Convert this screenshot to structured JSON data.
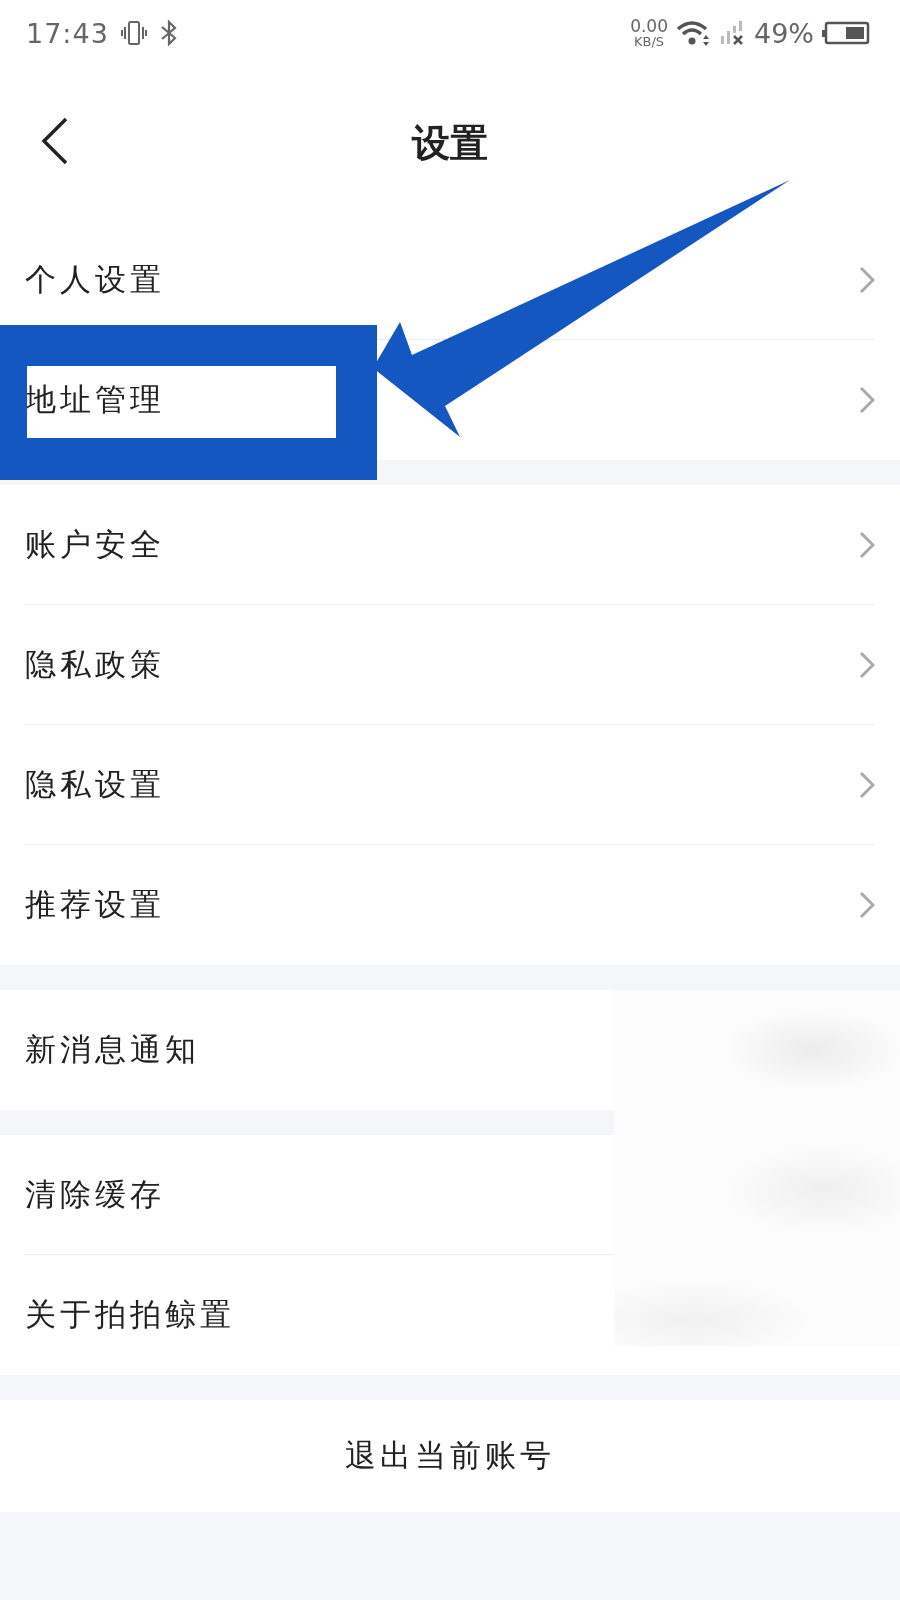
{
  "status_bar": {
    "time": "17:43",
    "speed_value": "0.00",
    "speed_unit": "KB/S",
    "battery": "49%"
  },
  "header": {
    "title": "设置"
  },
  "groups": [
    {
      "rows": [
        {
          "label": "个人设置",
          "kind": "nav"
        },
        {
          "label": "地址管理",
          "kind": "nav"
        }
      ]
    },
    {
      "rows": [
        {
          "label": "账户安全",
          "kind": "nav"
        },
        {
          "label": "隐私政策",
          "kind": "nav"
        },
        {
          "label": "隐私设置",
          "kind": "nav"
        },
        {
          "label": "推荐设置",
          "kind": "nav"
        }
      ]
    },
    {
      "rows": [
        {
          "label": "新消息通知",
          "kind": "plain"
        }
      ]
    },
    {
      "rows": [
        {
          "label": "清除缓存",
          "kind": "plain"
        },
        {
          "label": "关于拍拍鲸置",
          "kind": "plain"
        }
      ]
    }
  ],
  "logout_button": "退出当前账号"
}
